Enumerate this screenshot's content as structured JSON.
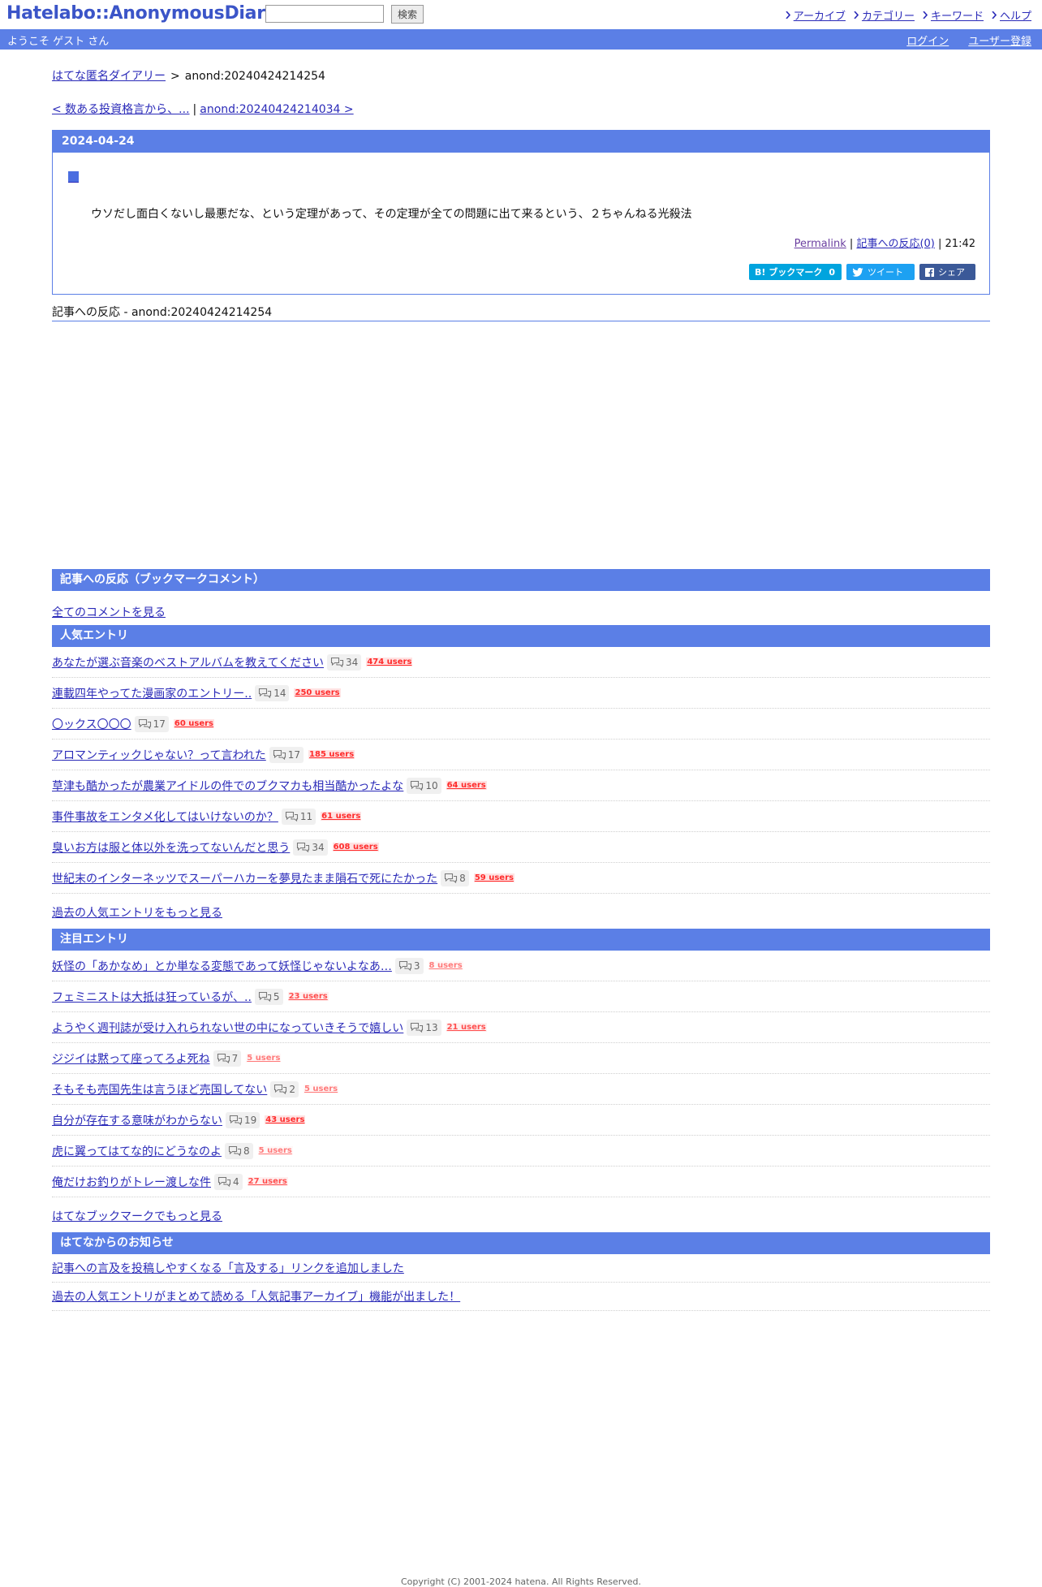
{
  "header": {
    "logo": "Hatelabo::AnonymousDiary",
    "search_placeholder": "",
    "search_button": "検索",
    "nav": [
      "アーカイブ",
      "カテゴリー",
      "キーワード",
      "ヘルプ"
    ],
    "welcome": "ようこそ ゲスト さん",
    "login": "ログイン",
    "register": "ユーザー登録"
  },
  "breadcrumb": {
    "root": "はてな匿名ダイアリー",
    "sep": ">",
    "current": "anond:20240424214254"
  },
  "pager": {
    "prev": "< 数ある投資格言から、...",
    "sep": "|",
    "next": "anond:20240424214034 >"
  },
  "entry": {
    "date": "2024-04-24",
    "body": "ウソだし面白くないし最悪だな、という定理があって、その定理が全ての問題に出て来るという、２ちゃんねる光殺法",
    "permalink": "Permalink",
    "meta_sep": "|",
    "reactions": "記事への反応(0)",
    "time": "21:42",
    "share": {
      "hatebu_label": "ブックマーク",
      "hatebu_icon_text": "B!",
      "hatebu_count": "0",
      "tweet": "ツイート",
      "fb": "シェア"
    }
  },
  "refs_title": "記事への反応 - anond:20240424214254",
  "bookmark_section": {
    "title": "記事への反応（ブックマークコメント）",
    "all_comments": "全てのコメントを見る"
  },
  "popular": {
    "title": "人気エントリ",
    "items": [
      {
        "title": "あなたが選ぶ音楽のベストアルバムを教えてください",
        "comments": "34",
        "users": "474 users",
        "level": "hot"
      },
      {
        "title": "連載四年やってた漫画家のエントリー..",
        "comments": "14",
        "users": "250 users",
        "level": "hot"
      },
      {
        "title": "〇ックス〇〇〇",
        "comments": "17",
        "users": "60 users",
        "level": "hot"
      },
      {
        "title": "アロマンティックじゃない？って言われた",
        "comments": "17",
        "users": "185 users",
        "level": "hot"
      },
      {
        "title": "草津も酷かったが農業アイドルの件でのブクマカも相当酷かったよな",
        "comments": "10",
        "users": "64 users",
        "level": "hot"
      },
      {
        "title": "事件事故をエンタメ化してはいけないのか？",
        "comments": "11",
        "users": "61 users",
        "level": "hot"
      },
      {
        "title": "臭いお方は服と体以外を洗ってないんだと思う",
        "comments": "34",
        "users": "608 users",
        "level": "hot"
      },
      {
        "title": "世紀末のインターネッツでスーパーハカーを夢見たまま隕石で死にたかった",
        "comments": "8",
        "users": "59 users",
        "level": "hot"
      }
    ],
    "more": "過去の人気エントリをもっと見る"
  },
  "featured": {
    "title": "注目エントリ",
    "items": [
      {
        "title": "妖怪の「あかなめ」とか単なる変態であって妖怪じゃないよなあ…",
        "comments": "3",
        "users": "8 users",
        "level": "low"
      },
      {
        "title": "フェミニストは大抵は狂っているが、..",
        "comments": "5",
        "users": "23 users",
        "level": "mid"
      },
      {
        "title": "ようやく週刊誌が受け入れられない世の中になっていきそうで嬉しい",
        "comments": "13",
        "users": "21 users",
        "level": "mid"
      },
      {
        "title": "ジジイは黙って座ってろよ死ね",
        "comments": "7",
        "users": "5 users",
        "level": "low"
      },
      {
        "title": "そもそも売国先生は言うほど売国してない",
        "comments": "2",
        "users": "5 users",
        "level": "low"
      },
      {
        "title": "自分が存在する意味がわからない",
        "comments": "19",
        "users": "43 users",
        "level": "hot"
      },
      {
        "title": "虎に翼ってはてな的にどうなのよ",
        "comments": "8",
        "users": "5 users",
        "level": "low"
      },
      {
        "title": "俺だけお釣りがトレー渡しな件",
        "comments": "4",
        "users": "27 users",
        "level": "mid"
      }
    ],
    "more": "はてなブックマークでもっと見る"
  },
  "news": {
    "title": "はてなからのお知らせ",
    "items": [
      "記事への言及を投稿しやすくなる「言及する」リンクを追加しました",
      "過去の人気エントリがまとめて読める「人気記事アーカイブ」機能が出ました！"
    ]
  },
  "footer": "Copyright (C) 2001-2024 hatena. All Rights Reserved.",
  "colors": {
    "accent": "#5b7fe6",
    "link": "#2a2ab8",
    "users_hot": "#ff2b2b"
  }
}
